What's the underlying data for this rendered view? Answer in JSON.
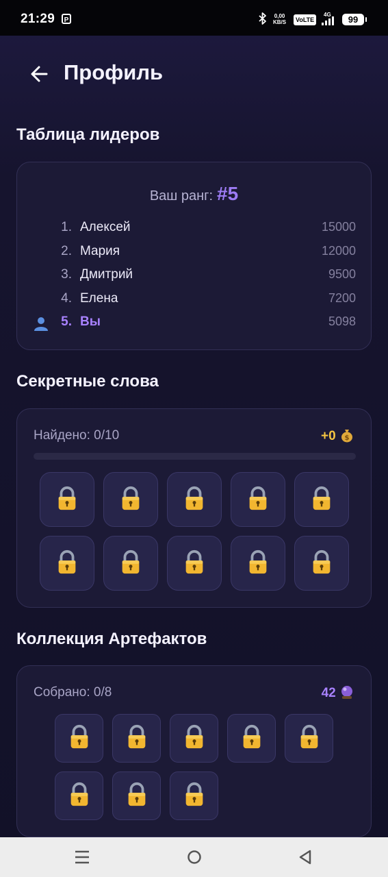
{
  "status_bar": {
    "time": "21:29",
    "speed_value": "0,00",
    "speed_unit": "KB/S",
    "volte": "VoLTE",
    "network": "4G",
    "battery": "99",
    "icons": [
      "parking-icon",
      "bluetooth-icon",
      "signal-icon"
    ]
  },
  "header": {
    "back_icon": "arrow-left-icon",
    "title": "Профиль"
  },
  "leaderboard": {
    "title": "Таблица лидеров",
    "rank_label": "Ваш ранг:",
    "rank_value": "#5",
    "rows": [
      {
        "pos": "1.",
        "name": "Алексей",
        "score": "15000"
      },
      {
        "pos": "2.",
        "name": "Мария",
        "score": "12000"
      },
      {
        "pos": "3.",
        "name": "Дмитрий",
        "score": "9500"
      },
      {
        "pos": "4.",
        "name": "Елена",
        "score": "7200"
      },
      {
        "pos": "5.",
        "name": "Вы",
        "score": "5098",
        "icon": "user-icon"
      }
    ]
  },
  "secret_words": {
    "title": "Секретные слова",
    "found": "Найдено: 0/10",
    "reward": "+0",
    "reward_icon": "money-bag-icon",
    "progress": 0,
    "slot_count": 10,
    "slot_icon": "lock-icon"
  },
  "artifacts": {
    "title": "Коллекция Артефактов",
    "collected": "Собрано: 0/8",
    "count": "42",
    "count_icon": "crystal-ball-icon",
    "slot_count": 8,
    "slot_icon": "lock-icon"
  },
  "nav_bar": {
    "icons": [
      "menu-icon",
      "home-icon",
      "back-icon"
    ]
  },
  "colors": {
    "accent": "#9d7cf5",
    "gold": "#f5c542",
    "background": "#16142e",
    "card": "#1c1a36"
  }
}
